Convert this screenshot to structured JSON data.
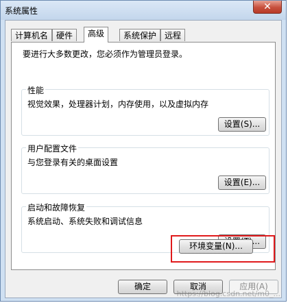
{
  "window": {
    "title": "系统属性",
    "close_label": "✕"
  },
  "tabs": [
    {
      "label": "计算机名",
      "active": false
    },
    {
      "label": "硬件",
      "active": false
    },
    {
      "label": "高级",
      "active": true
    },
    {
      "label": "系统保护",
      "active": false
    },
    {
      "label": "远程",
      "active": false
    }
  ],
  "advanced": {
    "note": "要进行大多数更改，您必须作为管理员登录。",
    "performance": {
      "title": "性能",
      "description": "视觉效果，处理器计划，内存使用，以及虚拟内存",
      "button": "设置(S)..."
    },
    "user_profiles": {
      "title": "用户配置文件",
      "description": "与您登录有关的桌面设置",
      "button": "设置(E)..."
    },
    "startup_recovery": {
      "title": "启动和故障恢复",
      "description": "系统启动、系统失败和调试信息",
      "button": "设置(T)..."
    },
    "env_button": "环境变量(N)..."
  },
  "footer": {
    "ok": "确定",
    "cancel": "取消",
    "apply": "应用(A)"
  },
  "watermark": "https://blog.csdn.net/m0_..."
}
